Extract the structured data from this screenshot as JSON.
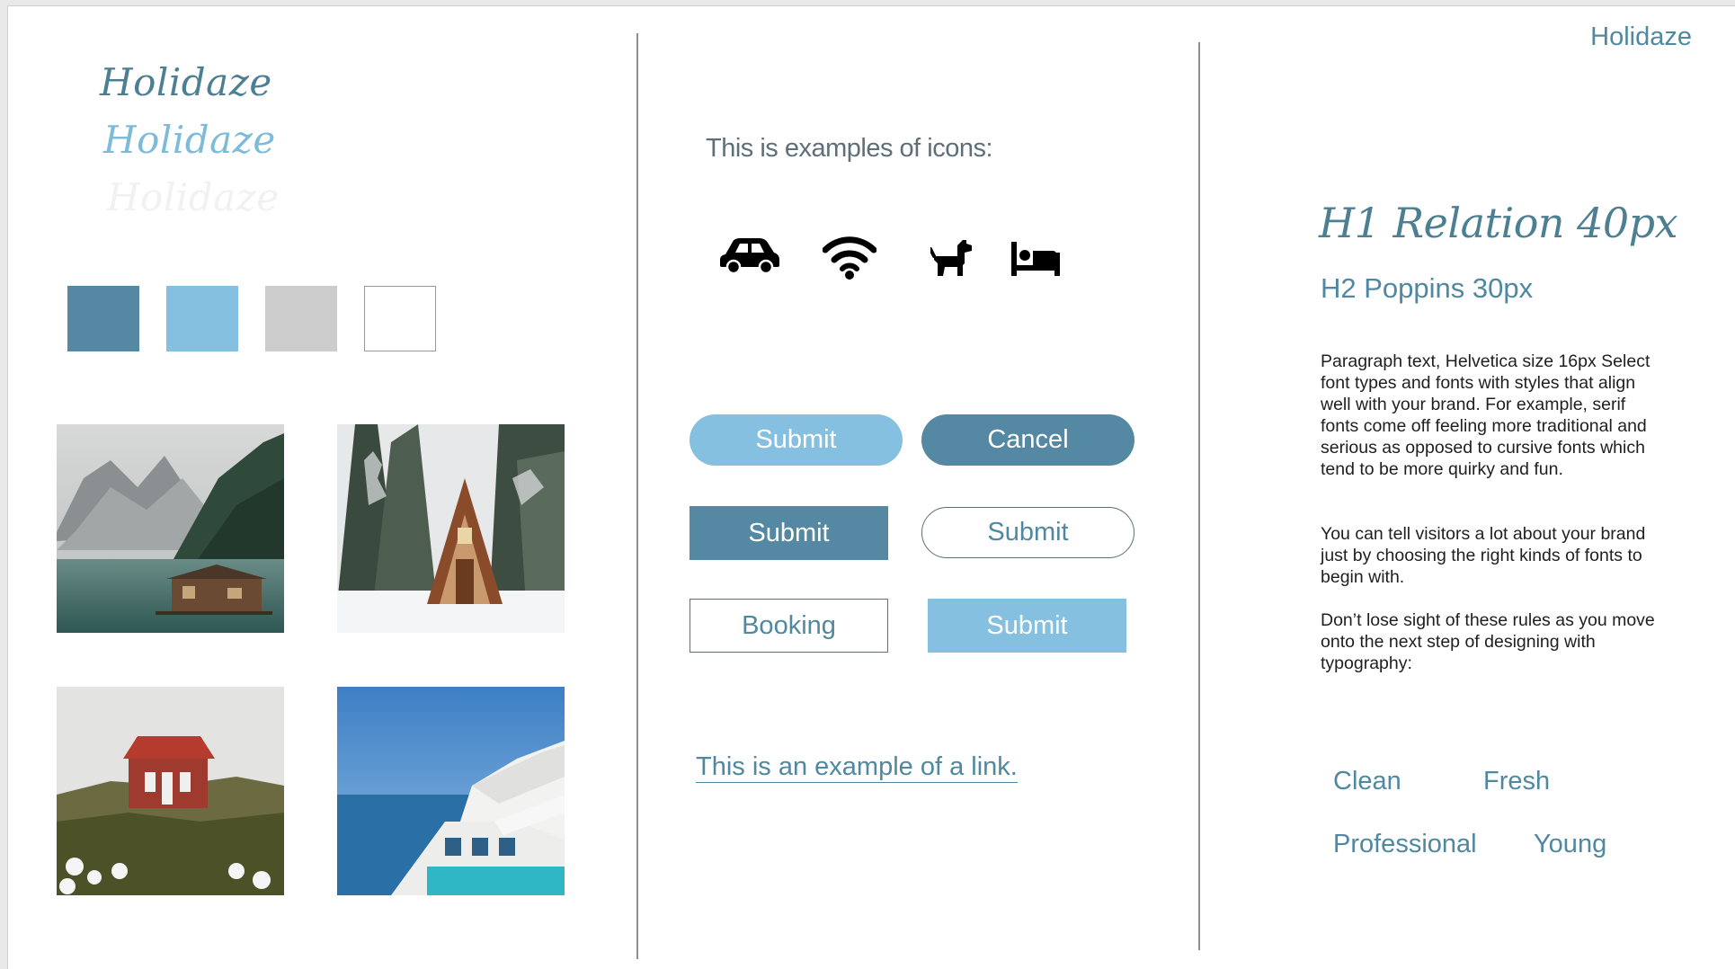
{
  "brand": {
    "name": "Holidaze",
    "logo_variants": [
      "Holidaze",
      "Holidaze",
      "Holidaze"
    ]
  },
  "palette": {
    "swatches": [
      "#5488a3",
      "#85c0e0",
      "#cccccc",
      "#ffffff"
    ]
  },
  "photos": [
    {
      "icon": "mountain-lake-cabin-photo"
    },
    {
      "icon": "snowy-a-frame-cabin-photo"
    },
    {
      "icon": "red-house-on-hill-photo"
    },
    {
      "icon": "santorini-pool-photo"
    }
  ],
  "icons_section": {
    "title": "This is examples of icons:",
    "icons": [
      "car-icon",
      "wifi-icon",
      "dog-icon",
      "bed-icon"
    ]
  },
  "buttons": {
    "submit_pill_light": "Submit",
    "cancel_pill_dark": "Cancel",
    "submit_square_dark": "Submit",
    "submit_pill_outline": "Submit",
    "booking_square_outline": "Booking",
    "submit_square_light": "Submit"
  },
  "link": {
    "text": "This is an example of a link."
  },
  "typography": {
    "h1": "H1 Relation 40px",
    "h2": "H2 Poppins 30px",
    "paragraph_1": "Paragraph text, Helvetica size 16px Select font types and fonts with styles that align well with your brand. For example, serif fonts come off feeling more traditional and serious as opposed to cursive fonts which tend to be more quirky and fun.",
    "paragraph_2": "You can tell visitors a lot about your brand just by choosing the right kinds of fonts to begin with.",
    "paragraph_3": "Don’t lose sight of these rules as you move onto the next step of designing with typography:"
  },
  "keywords": [
    "Clean",
    "Fresh",
    "Professional",
    "Young"
  ],
  "colors": {
    "dark_blue": "#5488a3",
    "light_blue": "#85c0e0",
    "text_blue": "#4f88a0",
    "grey": "#cccccc"
  }
}
